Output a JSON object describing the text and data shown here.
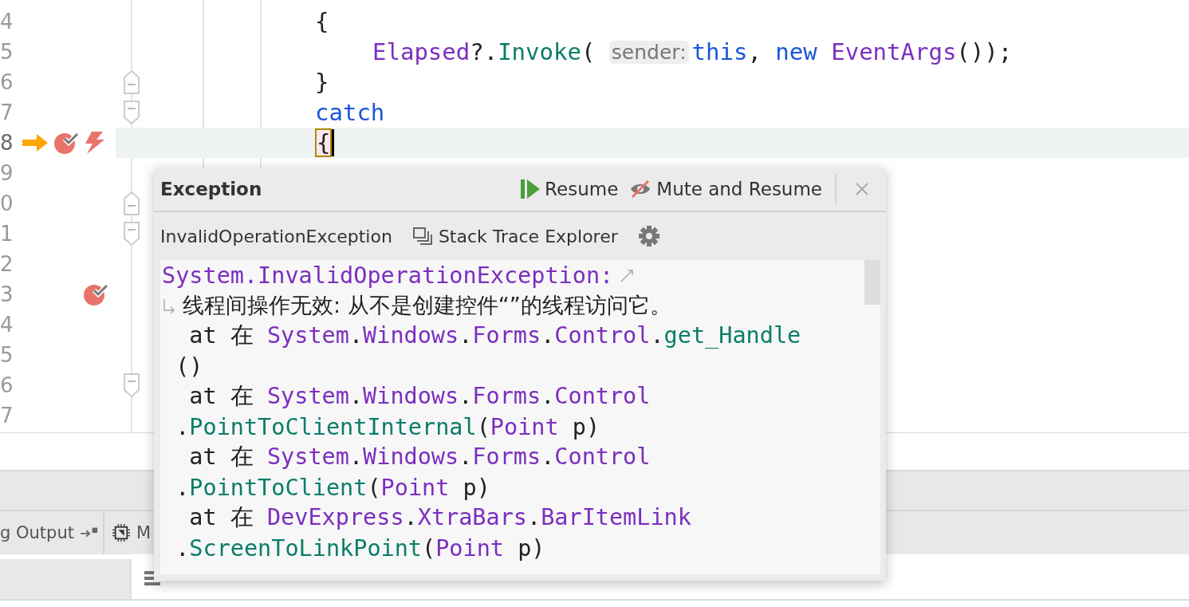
{
  "editor": {
    "lines": [
      {
        "number": "4",
        "current": false,
        "code": [
          {
            "kind": "plain",
            "text": "{"
          }
        ]
      },
      {
        "number": "5",
        "indented": true,
        "current": false,
        "code": [
          {
            "kind": "member",
            "text": "Elapsed"
          },
          {
            "kind": "plain",
            "text": "?."
          },
          {
            "kind": "method",
            "text": "Invoke"
          },
          {
            "kind": "plain",
            "text": "( "
          },
          {
            "kind": "hint",
            "text": "sender:"
          },
          {
            "kind": "keyword",
            "text": "this"
          },
          {
            "kind": "plain",
            "text": ", "
          },
          {
            "kind": "keyword",
            "text": "new"
          },
          {
            "kind": "member",
            "text": " EventArgs"
          },
          {
            "kind": "plain",
            "text": "());"
          }
        ]
      },
      {
        "number": "6",
        "fold_marker": {
          "kind": "end"
        },
        "current": false,
        "code": [
          {
            "kind": "plain",
            "text": "}"
          }
        ]
      },
      {
        "number": "7",
        "fold_marker": {
          "kind": "start"
        },
        "current": false,
        "code": [
          {
            "kind": "keyword",
            "text": "catch"
          }
        ]
      },
      {
        "number": "8",
        "gutter": [
          {
            "kind": "pointer"
          },
          {
            "kind": "breakpoint"
          },
          {
            "kind": "exception"
          }
        ],
        "current": true,
        "code": [
          {
            "kind": "brace-match",
            "text": "{"
          },
          {
            "kind": "caret"
          }
        ]
      },
      {
        "number": "9",
        "current": false
      },
      {
        "number": "0",
        "fold_marker": {
          "kind": "end"
        },
        "current": false
      },
      {
        "number": "1",
        "fold_marker": {
          "kind": "start"
        },
        "current": false
      },
      {
        "number": "2",
        "current": false
      },
      {
        "number": "3",
        "gutter": [
          {
            "kind": "empty"
          },
          {
            "kind": "empty"
          },
          {
            "kind": "breakpoint"
          }
        ],
        "current": false
      },
      {
        "number": "4",
        "current": false
      },
      {
        "number": "5",
        "current": false
      },
      {
        "number": "6",
        "fold_marker": {
          "kind": "start"
        },
        "current": false
      },
      {
        "number": "7",
        "current": false
      }
    ]
  },
  "tool_tabs": [
    {
      "label": "g Output",
      "kind": "output"
    },
    {
      "label": "M",
      "kind": "memory"
    }
  ],
  "popup": {
    "title": "Exception",
    "actions": [
      {
        "label": "Resume",
        "kind": "resume"
      },
      {
        "label": "Mute and Resume",
        "kind": "mute"
      }
    ],
    "exception_type": "InvalidOperationException",
    "explorer_label": "Stack Trace Explorer",
    "stack_trace": [
      [
        {
          "kind": "type",
          "text": "System.InvalidOperationException:"
        },
        {
          "kind": "wrap-icon"
        }
      ],
      [
        {
          "kind": "wrap-icon"
        },
        {
          "kind": "message",
          "text": "线程间操作无效: 从不是创建控件“”的线程访问它。"
        }
      ],
      [
        {
          "kind": "plain",
          "text": "  at 在 "
        },
        {
          "kind": "type",
          "text": "System"
        },
        {
          "kind": "plain",
          "text": "."
        },
        {
          "kind": "type",
          "text": "Windows"
        },
        {
          "kind": "plain",
          "text": "."
        },
        {
          "kind": "type",
          "text": "Forms"
        },
        {
          "kind": "plain",
          "text": "."
        },
        {
          "kind": "type",
          "text": "Control"
        },
        {
          "kind": "plain",
          "text": "."
        },
        {
          "kind": "method",
          "text": "get_Handle"
        }
      ],
      [
        {
          "kind": "plain",
          "text": " ()"
        }
      ],
      [
        {
          "kind": "plain",
          "text": "  at 在 "
        },
        {
          "kind": "type",
          "text": "System"
        },
        {
          "kind": "plain",
          "text": "."
        },
        {
          "kind": "type",
          "text": "Windows"
        },
        {
          "kind": "plain",
          "text": "."
        },
        {
          "kind": "type",
          "text": "Forms"
        },
        {
          "kind": "plain",
          "text": "."
        },
        {
          "kind": "type",
          "text": "Control"
        }
      ],
      [
        {
          "kind": "plain",
          "text": " ."
        },
        {
          "kind": "method",
          "text": "PointToClientInternal"
        },
        {
          "kind": "plain",
          "text": "("
        },
        {
          "kind": "type",
          "text": "Point"
        },
        {
          "kind": "plain",
          "text": " p)"
        }
      ],
      [
        {
          "kind": "plain",
          "text": "  at 在 "
        },
        {
          "kind": "type",
          "text": "System"
        },
        {
          "kind": "plain",
          "text": "."
        },
        {
          "kind": "type",
          "text": "Windows"
        },
        {
          "kind": "plain",
          "text": "."
        },
        {
          "kind": "type",
          "text": "Forms"
        },
        {
          "kind": "plain",
          "text": "."
        },
        {
          "kind": "type",
          "text": "Control"
        }
      ],
      [
        {
          "kind": "plain",
          "text": " ."
        },
        {
          "kind": "method",
          "text": "PointToClient"
        },
        {
          "kind": "plain",
          "text": "("
        },
        {
          "kind": "type",
          "text": "Point"
        },
        {
          "kind": "plain",
          "text": " p)"
        }
      ],
      [
        {
          "kind": "plain",
          "text": "  at 在 "
        },
        {
          "kind": "type",
          "text": "DevExpress"
        },
        {
          "kind": "plain",
          "text": "."
        },
        {
          "kind": "type",
          "text": "XtraBars"
        },
        {
          "kind": "plain",
          "text": "."
        },
        {
          "kind": "type",
          "text": "BarItemLink"
        }
      ],
      [
        {
          "kind": "plain",
          "text": " ."
        },
        {
          "kind": "method",
          "text": "ScreenToLinkPoint"
        },
        {
          "kind": "plain",
          "text": "("
        },
        {
          "kind": "type",
          "text": "Point"
        },
        {
          "kind": "plain",
          "text": " p)"
        }
      ]
    ]
  }
}
